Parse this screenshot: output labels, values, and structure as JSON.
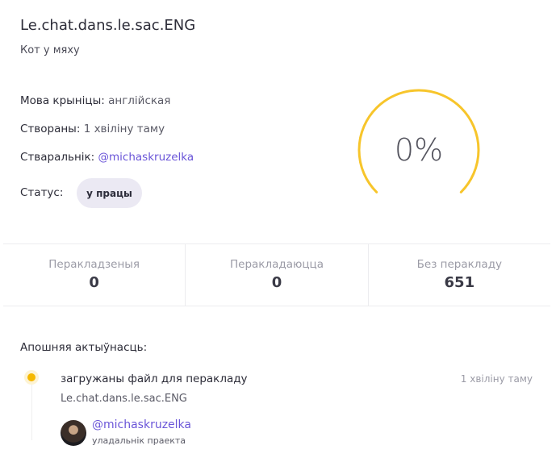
{
  "project": {
    "title": "Le.chat.dans.le.sac.ENG",
    "subtitle": "Кот у мяху"
  },
  "meta": {
    "source_language_label": "Мова крыніцы:",
    "source_language_value": "англійская",
    "created_label": "Створаны:",
    "created_value": "1 хвіліну таму",
    "author_label": "Стваральнік:",
    "author_value": "@michaskruzelka",
    "status_label": "Статус:",
    "status_value": "у працы"
  },
  "progress": {
    "label": "0%",
    "percent": 0,
    "color": "#f7c52b"
  },
  "stats": [
    {
      "label": "Перакладзеныя",
      "value": "0"
    },
    {
      "label": "Перакладаюцца",
      "value": "0"
    },
    {
      "label": "Без перакладу",
      "value": "651"
    }
  ],
  "activity": {
    "heading": "Апошняя актыўнасць:",
    "items": [
      {
        "title": "загружаны файл для перакладу",
        "time": "1 хвіліну таму",
        "file": "Le.chat.dans.le.sac.ENG",
        "user": "@michaskruzelka",
        "role": "уладальнік праекта"
      }
    ]
  },
  "colors": {
    "accent": "#6a55d8",
    "dot": "#f5b800"
  }
}
